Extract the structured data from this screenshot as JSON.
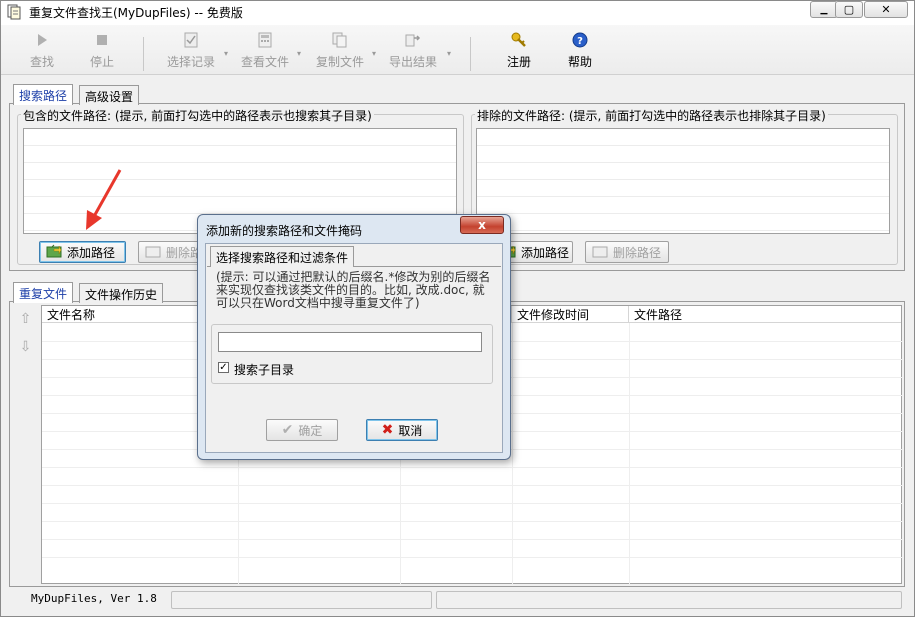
{
  "window": {
    "title": "重复文件查找王(MyDupFiles) -- 免费版",
    "min_glyph": "▁",
    "max_glyph": "▢",
    "close_glyph": "✕"
  },
  "toolbar": {
    "search": "查找",
    "stop": "停止",
    "select_records": "选择记录",
    "view_files": "查看文件",
    "copy_files": "复制文件",
    "export_results": "导出结果",
    "register": "注册",
    "help": "帮助"
  },
  "top_tabs": [
    "搜索路径",
    "高级设置"
  ],
  "include_group": {
    "label": "包含的文件路径: (提示, 前面打勾选中的路径表示也搜索其子目录)",
    "add_button": "添加路径",
    "delete_button": "删除路径"
  },
  "exclude_group": {
    "label": "排除的文件路径: (提示, 前面打勾选中的路径表示也排除其子目录)",
    "add_button": "添加路径",
    "delete_button": "删除路径"
  },
  "bottom_tabs": [
    "重复文件",
    "文件操作历史"
  ],
  "results_columns": [
    "文件名称",
    "文件修改时间",
    "文件路径"
  ],
  "status": {
    "version": "MyDupFiles, Ver 1.8"
  },
  "dialog": {
    "title": "添加新的搜索路径和文件掩码",
    "close_glyph": "x",
    "tab": "选择搜索路径和过滤条件",
    "hint": "(提示: 可以通过把默认的后缀名.*修改为别的后缀名来实现仅查找该类文件的目的。比如, 改成.doc, 就可以只在Word文档中搜寻重复文件了)",
    "path_value": "",
    "checkbox_label": "搜索子目录",
    "checkbox_checked": true,
    "check_mark": "✓",
    "ok_button": "确定",
    "cancel_button": "取消"
  },
  "colors": {
    "accent_tab": "#1d3fa8",
    "arrow": "#e8372c"
  }
}
